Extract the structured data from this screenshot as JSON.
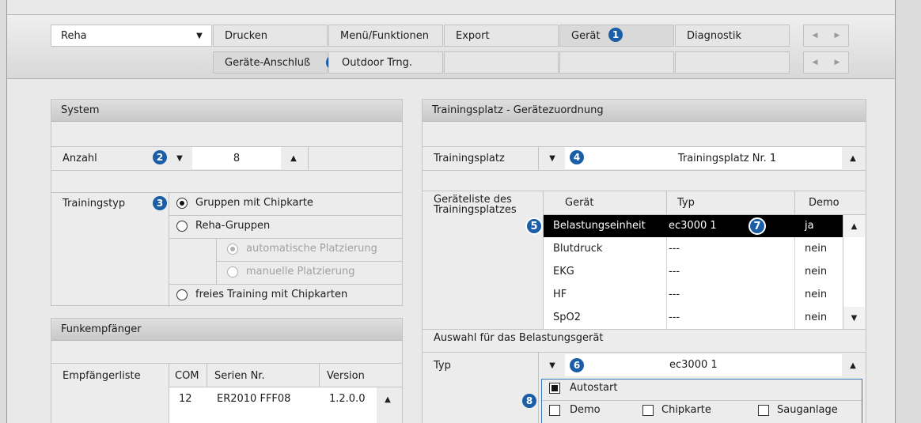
{
  "top": {
    "module_select": "Reha",
    "menu_row1": [
      "Drucken",
      "Menü/Funktionen",
      "Export",
      "Gerät",
      "Diagnostik"
    ],
    "menu_row2": [
      "Geräte-Anschluß",
      "Outdoor Trng."
    ],
    "badge_geraet": "1",
    "badge_anschluss": "1"
  },
  "system": {
    "title": "System",
    "anzahl_label": "Anzahl",
    "anzahl_value": "8",
    "badge_anzahl": "2",
    "trainingstyp_label": "Trainingstyp",
    "badge_trainingstyp": "3",
    "options": [
      {
        "label": "Gruppen mit Chipkarte",
        "selected": true
      },
      {
        "label": "Reha-Gruppen",
        "selected": false
      },
      {
        "label": "automatische Platzierung",
        "selected": true,
        "disabled": true
      },
      {
        "label": "manuelle Platzierung",
        "selected": false,
        "disabled": true
      },
      {
        "label": "freies Training mit Chipkarten",
        "selected": false
      }
    ]
  },
  "funk": {
    "title": "Funkempfänger",
    "list_label": "Empfängerliste",
    "columns": [
      "COM",
      "Serien Nr.",
      "Version"
    ],
    "rows": [
      [
        "12",
        "ER2010 FFF08",
        "1.2.0.0"
      ]
    ]
  },
  "trainingsplatz": {
    "title": "Trainingsplatz - Gerätezuordnung",
    "label": "Trainingsplatz",
    "value": "Trainingsplatz Nr. 1",
    "badge": "4",
    "list_label": "Geräteliste des Trainingsplatzes",
    "columns": [
      "Gerät",
      "Typ",
      "Demo"
    ],
    "rows": [
      [
        "Belastungseinheit",
        "ec3000 1",
        "ja"
      ],
      [
        "Blutdruck",
        "---",
        "nein"
      ],
      [
        "EKG",
        "---",
        "nein"
      ],
      [
        "HF",
        "---",
        "nein"
      ],
      [
        "SpO2",
        "---",
        "nein"
      ]
    ],
    "badge_row": "5",
    "badge_typ": "7"
  },
  "belastung": {
    "title": "Auswahl für das Belastungsgerät",
    "typ_label": "Typ",
    "typ_value": "ec3000 1",
    "badge": "6",
    "badge_options": "8",
    "autostart": "Autostart",
    "demo": "Demo",
    "chipkarte": "Chipkarte",
    "sauganlage": "Sauganlage"
  },
  "colors": {
    "accent_badge": "#1b5ea8",
    "selected_row": "#000000"
  }
}
